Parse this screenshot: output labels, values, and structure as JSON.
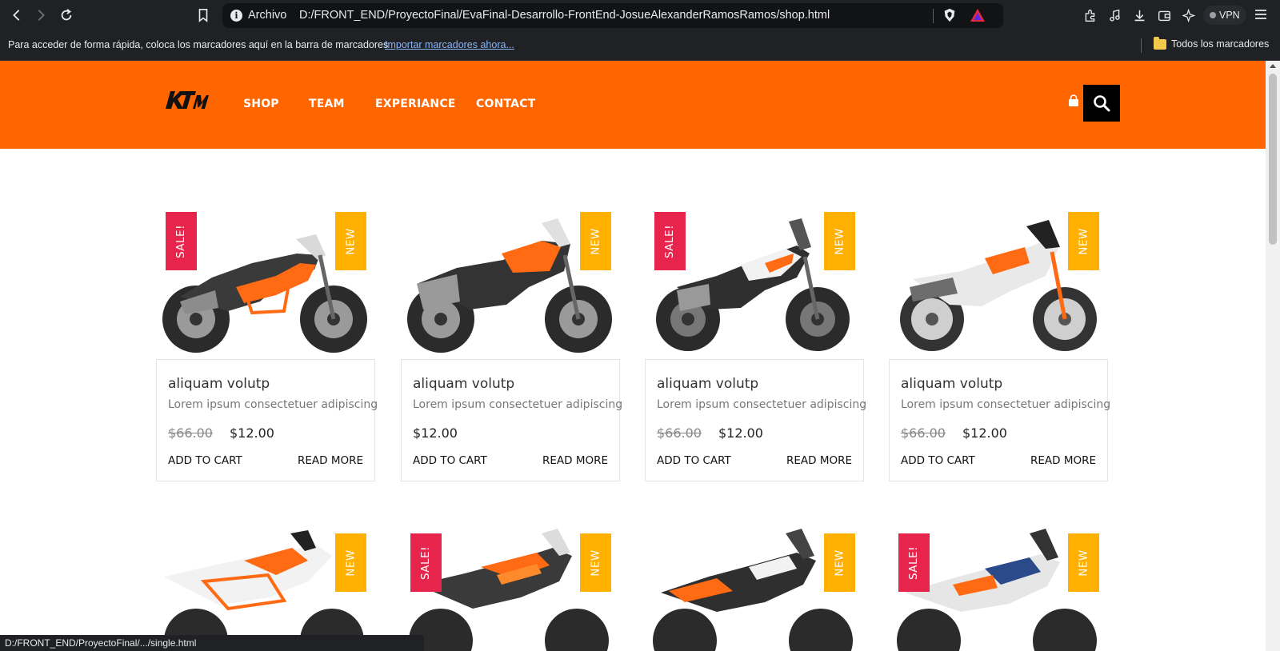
{
  "browser": {
    "scheme_label": "Archivo",
    "url": "D:/FRONT_END/ProyectoFinal/EvaFinal-Desarrollo-FrontEnd-JosueAlexanderRamosRamos/shop.html",
    "vpn_label": "VPN",
    "bookmarks_hint": "Para acceder de forma rápida, coloca los marcadores aquí en la barra de marcadores",
    "bookmarks_import": "Importar marcadores ahora...",
    "all_bookmarks": "Todos los marcadores",
    "status_url": "D:/FRONT_END/ProyectoFinal/.../single.html"
  },
  "site": {
    "brand": "KTM",
    "nav": [
      "SHOP",
      "TEAM",
      "EXPERIANCE",
      "CONTACT"
    ],
    "accent_color": "#ff6600"
  },
  "products": [
    {
      "sale": "SALE!",
      "new": "NEW",
      "title": "aliquam volutp",
      "desc": "Lorem ipsum consectetuer adipiscing",
      "old_price": "$66.00",
      "price": "$12.00",
      "add": "ADD TO CART",
      "read": "READ MORE"
    },
    {
      "sale": "",
      "new": "NEW",
      "title": "aliquam volutp",
      "desc": "Lorem ipsum consectetuer adipiscing",
      "old_price": "",
      "price": "$12.00",
      "add": "ADD TO CART",
      "read": "READ MORE"
    },
    {
      "sale": "SALE!",
      "new": "NEW",
      "title": "aliquam volutp",
      "desc": "Lorem ipsum consectetuer adipiscing",
      "old_price": "$66.00",
      "price": "$12.00",
      "add": "ADD TO CART",
      "read": "READ MORE"
    },
    {
      "sale": "",
      "new": "NEW",
      "title": "aliquam volutp",
      "desc": "Lorem ipsum consectetuer adipiscing",
      "old_price": "$66.00",
      "price": "$12.00",
      "add": "ADD TO CART",
      "read": "READ MORE"
    },
    {
      "sale": "",
      "new": "NEW"
    },
    {
      "sale": "SALE!",
      "new": "NEW"
    },
    {
      "sale": "",
      "new": "NEW"
    },
    {
      "sale": "SALE!",
      "new": "NEW"
    }
  ]
}
